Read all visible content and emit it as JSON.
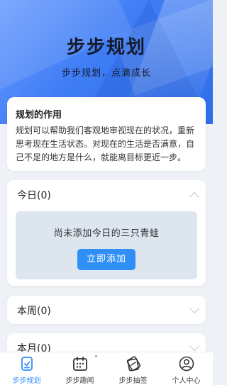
{
  "header": {
    "title": "步步规划",
    "subtitle": "步步规划，点滴成长"
  },
  "intro": {
    "heading": "规划的作用",
    "body": "规划可以帮助我们客观地审视现在的状况，重新思考现在生活状态。对现在的生活是否满意，自己不足的地方是什么，就能离目标更近一步。"
  },
  "sections": {
    "today": {
      "label": "今日(0)",
      "expanded": true
    },
    "week": {
      "label": "本周(0)",
      "expanded": false
    },
    "month": {
      "label": "本月(0)",
      "expanded": false
    }
  },
  "empty_state": {
    "message": "尚未添加今日的三只青蛙",
    "button_label": "立即添加"
  },
  "tabbar": {
    "items": [
      {
        "label": "步步规划",
        "icon": "plan-icon",
        "active": true
      },
      {
        "label": "步步趣闻",
        "icon": "calendar-icon",
        "active": false
      },
      {
        "label": "步步抽签",
        "icon": "lottery-icon",
        "active": false
      },
      {
        "label": "个人中心",
        "icon": "user-icon",
        "active": false
      }
    ]
  },
  "colors": {
    "accent": "#2f8ff7",
    "hero_blue": "#3f7df5",
    "background": "#eef1f5"
  }
}
